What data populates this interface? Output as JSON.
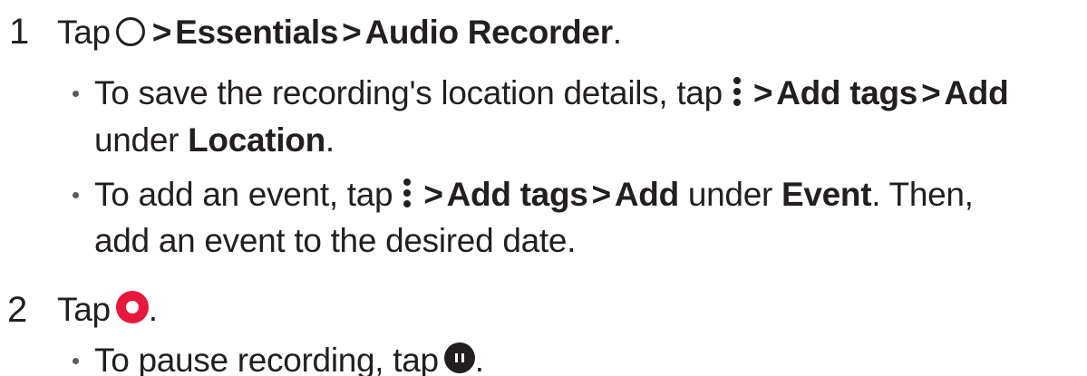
{
  "steps": [
    {
      "number": "1",
      "tap": "Tap",
      "icon": "home-circle-icon",
      "sep": ">",
      "essentials": "Essentials",
      "audio_recorder": "Audio Recorder",
      "end": "."
    },
    {
      "number": "2",
      "tap": "Tap",
      "icon": "record-icon",
      "end": "."
    }
  ],
  "bullets": [
    {
      "line1_a": "To save the recording's location details, tap",
      "icon": "more-options-icon",
      "add_tags": "Add tags",
      "add": "Add",
      "line2_a": "under",
      "location": "Location",
      "end": "."
    },
    {
      "line1_a": "To add an event, tap",
      "icon": "more-options-icon",
      "add_tags": "Add tags",
      "add": "Add",
      "under": "under",
      "event": "Event",
      "then": ". Then,",
      "line2": "add an event to the desired date."
    },
    {
      "text": "To pause recording, tap",
      "icon": "pause-icon",
      "end": "."
    }
  ],
  "colors": {
    "text": "#231f20",
    "record": "#e8173c"
  }
}
